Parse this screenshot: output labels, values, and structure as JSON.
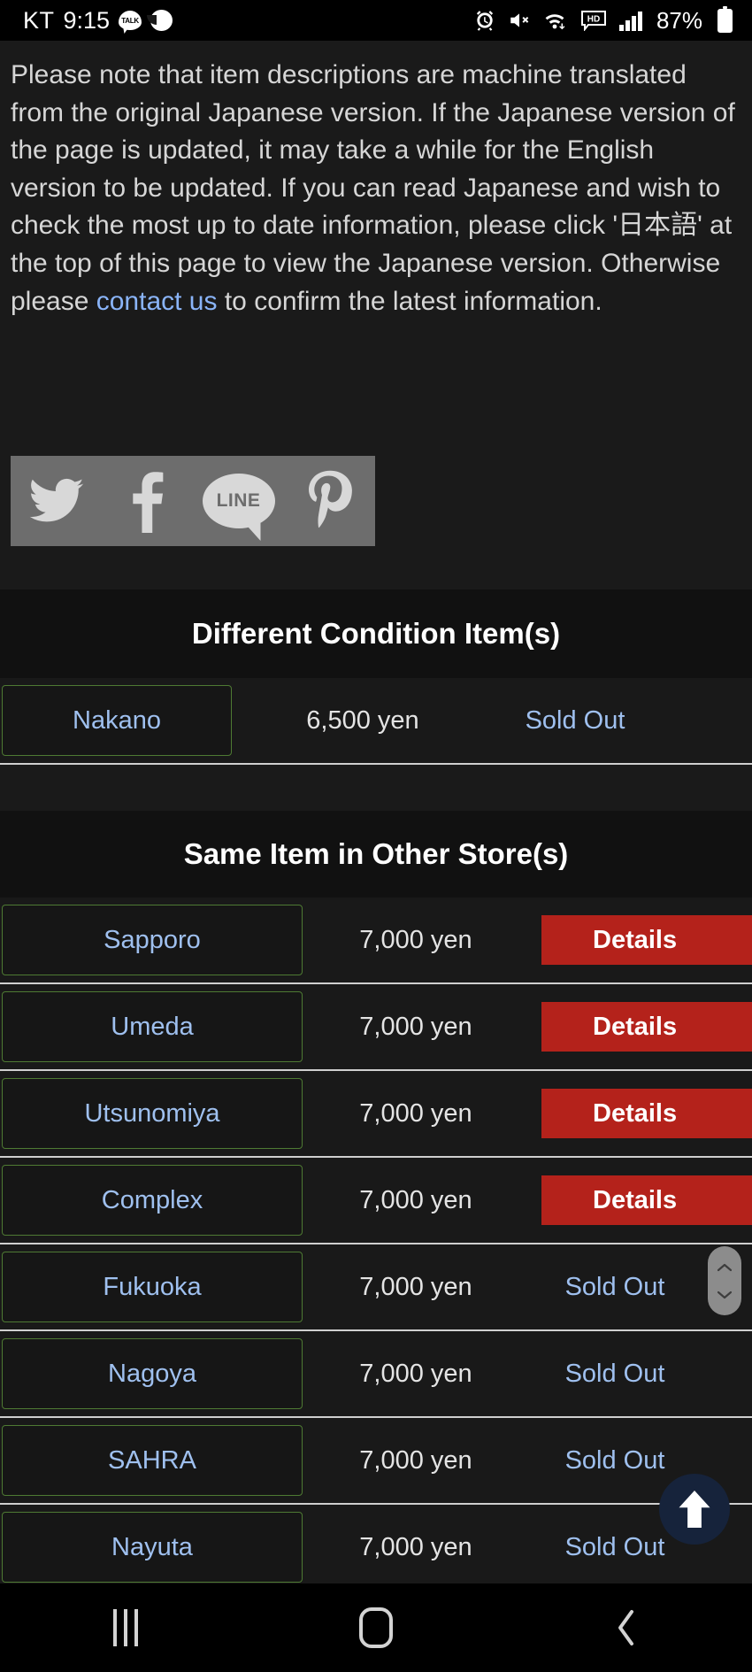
{
  "status_bar": {
    "carrier": "KT",
    "time": "9:15",
    "kakao_talk_label": "TALK",
    "battery_percent": "87%",
    "icons": [
      "kakaotalk-icon",
      "kakao-channel-icon",
      "alarm-icon",
      "mute-icon",
      "wifi-icon",
      "hd-icon",
      "signal-icon",
      "battery-icon"
    ]
  },
  "notice": {
    "part1": "Please note that item descriptions are machine translated from the original Japanese version. If the Japanese version of the page is updated, it may take a while for the English version to be updated. If you can read Japanese and wish to check the most up to date information, please click '日本語' at the top of this page to view the Japanese version. Otherwise please ",
    "link_text": "contact us",
    "part2": " to confirm the latest information."
  },
  "share": {
    "buttons": [
      {
        "name": "twitter",
        "label": "Twitter"
      },
      {
        "name": "facebook",
        "label": "Facebook"
      },
      {
        "name": "line",
        "label": "LINE"
      },
      {
        "name": "pinterest",
        "label": "Pinterest"
      }
    ]
  },
  "different_condition": {
    "heading": "Different Condition Item(s)",
    "rows": [
      {
        "store": "Nakano",
        "price": "6,500 yen",
        "status": "Sold Out",
        "action": null
      }
    ]
  },
  "other_stores": {
    "heading": "Same Item in Other Store(s)",
    "details_label": "Details",
    "rows": [
      {
        "store": "Sapporo",
        "price": "7,000 yen",
        "status": null,
        "action": "Details"
      },
      {
        "store": "Umeda",
        "price": "7,000 yen",
        "status": null,
        "action": "Details"
      },
      {
        "store": "Utsunomiya",
        "price": "7,000 yen",
        "status": null,
        "action": "Details"
      },
      {
        "store": "Complex",
        "price": "7,000 yen",
        "status": null,
        "action": "Details"
      },
      {
        "store": "Fukuoka",
        "price": "7,000 yen",
        "status": "Sold Out",
        "action": null
      },
      {
        "store": "Nagoya",
        "price": "7,000 yen",
        "status": "Sold Out",
        "action": null
      },
      {
        "store": "SAHRA",
        "price": "7,000 yen",
        "status": "Sold Out",
        "action": null
      },
      {
        "store": "Nayuta",
        "price": "7,000 yen",
        "status": "Sold Out",
        "action": null
      }
    ]
  },
  "scroll_to_top": {
    "label": "Scroll to top"
  },
  "scrollbar": {
    "label": "Page scrollbar handle"
  },
  "nav_bar": {
    "items": [
      {
        "name": "recents",
        "label": "Recents"
      },
      {
        "name": "home",
        "label": "Home"
      },
      {
        "name": "back",
        "label": "Back"
      }
    ]
  },
  "colors": {
    "page_bg": "#1a1a1a",
    "heading_bg": "#111111",
    "row_bg": "#191919",
    "row_divider": "#cfcfcf",
    "store_border_green": "#4e7a33",
    "link_blue": "#9fc0ef",
    "details_red": "#b4221b",
    "share_bar_gray": "#6d6d6d",
    "fab_navy": "#16233b"
  }
}
